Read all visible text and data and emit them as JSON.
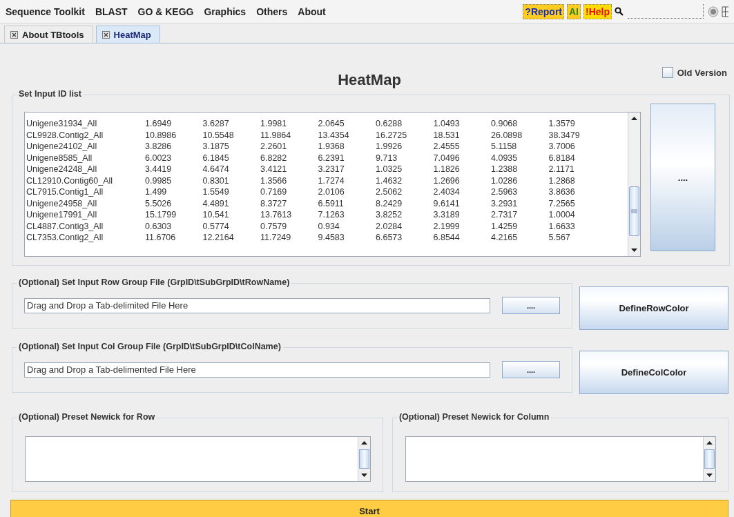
{
  "menu": [
    "Sequence Toolkit",
    "BLAST",
    "GO & KEGG",
    "Graphics",
    "Others",
    "About"
  ],
  "toolbar": [
    {
      "label": "?Report",
      "kind": "report"
    },
    {
      "label": "AI",
      "kind": "ai"
    },
    {
      "label": "!Help",
      "kind": "help"
    }
  ],
  "tabs": [
    {
      "label": "About TBtools",
      "selected": false
    },
    {
      "label": "HeatMap",
      "selected": true
    }
  ],
  "title": "HeatMap",
  "old_version": {
    "label": "Old Version",
    "checked": false
  },
  "id_list": {
    "legend": "Set Input ID list",
    "browse_button": "....",
    "rows": [
      {
        "name": "Unigene31934_All",
        "values": [
          "1.6949",
          "3.6287",
          "1.9981",
          "2.0645",
          "0.6288",
          "1.0493",
          "0.9068",
          "1.3579"
        ]
      },
      {
        "name": "CL9928.Contig2_All",
        "values": [
          "10.8986",
          "10.5548",
          "11.9864",
          "13.4354",
          "16.2725",
          "18.531",
          "26.0898",
          "38.3479"
        ]
      },
      {
        "name": "Unigene24102_All",
        "values": [
          "3.8286",
          "3.1875",
          "2.2601",
          "1.9368",
          "1.9926",
          "2.4555",
          "5.1158",
          "3.7006"
        ]
      },
      {
        "name": "Unigene8585_All",
        "values": [
          "6.0023",
          "6.1845",
          "6.8282",
          "6.2391",
          "9.713",
          "7.0496",
          "4.0935",
          "6.8184"
        ]
      },
      {
        "name": "Unigene24248_All",
        "values": [
          "3.4419",
          "4.6474",
          "3.4121",
          "3.2317",
          "1.0325",
          "1.1826",
          "1.2388",
          "2.1171"
        ]
      },
      {
        "name": "CL12910.Contig60_All",
        "values": [
          "0.9985",
          "0.8301",
          "1.3566",
          "1.7274",
          "1.4632",
          "1.2696",
          "1.0286",
          "1.2868"
        ]
      },
      {
        "name": "CL7915.Contig1_All",
        "values": [
          "1.499",
          "1.5549",
          "0.7169",
          "2.0106",
          "2.5062",
          "2.4034",
          "2.5963",
          "3.8636"
        ]
      },
      {
        "name": "Unigene24958_All",
        "values": [
          "5.5026",
          "4.4891",
          "8.3727",
          "6.5911",
          "8.2429",
          "9.6141",
          "3.2931",
          "7.2565"
        ]
      },
      {
        "name": "Unigene17991_All",
        "values": [
          "15.1799",
          "10.541",
          "13.7613",
          "7.1263",
          "3.8252",
          "3.3189",
          "2.7317",
          "1.0004"
        ]
      },
      {
        "name": "CL4887.Contig3_All",
        "values": [
          "0.6303",
          "0.5774",
          "0.7579",
          "0.934",
          "2.0284",
          "2.1999",
          "1.4259",
          "1.6633"
        ]
      },
      {
        "name": "CL7353.Contig2_All",
        "values": [
          "11.6706",
          "12.2164",
          "11.7249",
          "9.4583",
          "6.6573",
          "6.8544",
          "4.2165",
          "5.567"
        ]
      }
    ]
  },
  "group_files": [
    {
      "legend": "(Optional) Set Input Row Group File (GrpID\\tSubGrpID\\tRowName)",
      "value": "Drag and Drop a Tab-delimited File Here",
      "browse_button": "....",
      "define_button": "DefineRowColor"
    },
    {
      "legend": "(Optional) Set Input Col Group File (GrpID\\tSubGrpID\\tColName)",
      "value": "Drag and Drop a Tab-delimented File Here",
      "browse_button": "....",
      "define_button": "DefineColColor"
    }
  ],
  "newick": [
    {
      "legend": "(Optional) Preset Newick for Row"
    },
    {
      "legend": "(Optional) Preset Newick for Column"
    }
  ],
  "start_button": "Start"
}
